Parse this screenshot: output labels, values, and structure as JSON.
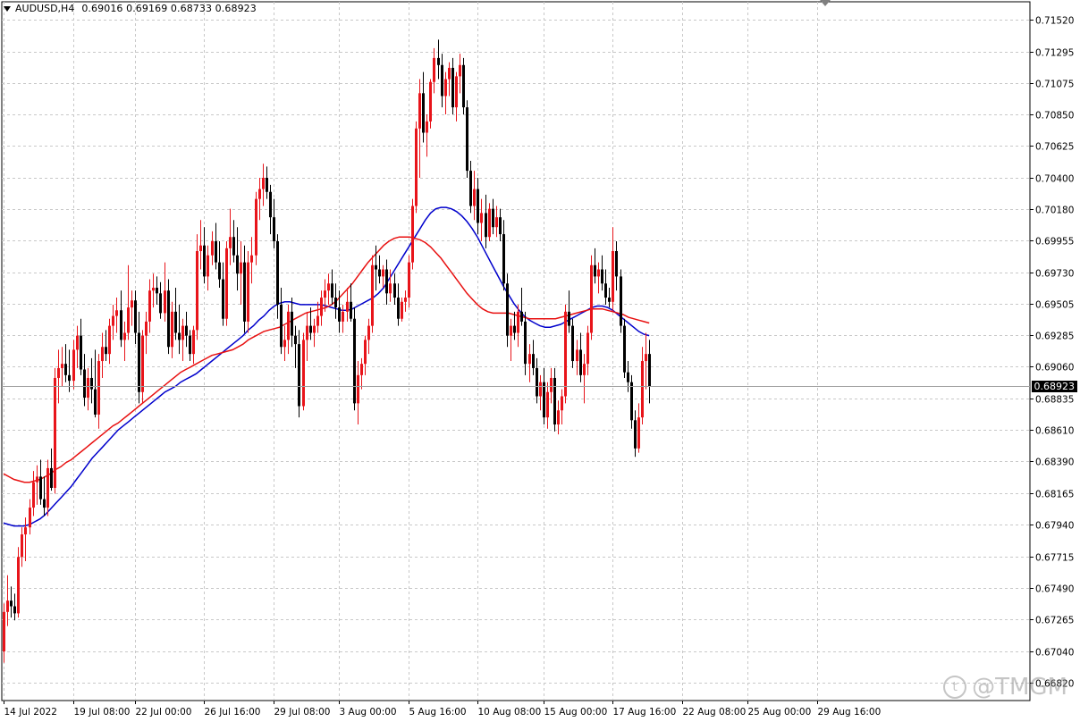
{
  "header": {
    "symbol": "AUDUSD,H4",
    "ohlc": "0.69016 0.69169 0.68733 0.68923"
  },
  "current_price": "0.68923",
  "watermark": "@TMGM",
  "colors": {
    "bull": "#e8141a",
    "bear": "#000000",
    "ma_fast": "#0000cc",
    "ma_slow": "#e81010",
    "grid": "#c8c8c8",
    "axis": "#000000"
  },
  "chart_data": {
    "type": "candlestick",
    "title": "AUDUSD,H4",
    "xlabel": "",
    "ylabel": "",
    "grid": true,
    "y_ticks": [
      "0.71520",
      "0.71295",
      "0.71075",
      "0.70850",
      "0.70625",
      "0.70400",
      "0.70180",
      "0.69955",
      "0.69730",
      "0.69505",
      "0.69285",
      "0.69060",
      "0.68835",
      "0.68610",
      "0.68390",
      "0.68165",
      "0.67940",
      "0.67715",
      "0.67490",
      "0.67265",
      "0.67040",
      "0.66820"
    ],
    "ylim": [
      0.6678,
      0.7156
    ],
    "x_tick_labels": [
      "14 Jul 2022",
      "19 Jul 08:00",
      "22 Jul 00:00",
      "26 Jul 16:00",
      "29 Jul 08:00",
      "3 Aug 00:00",
      "5 Aug 16:00",
      "10 Aug 08:00",
      "15 Aug 00:00",
      "17 Aug 16:00",
      "22 Aug 08:00",
      "25 Aug 00:00",
      "29 Aug 16:00"
    ],
    "x_tick_index": [
      0,
      19,
      36,
      55,
      74,
      92,
      111,
      130,
      148,
      167,
      186,
      204,
      223
    ],
    "last_price": 0.68923,
    "candles": [
      [
        0.6704,
        0.6738,
        0.6696,
        0.6732
      ],
      [
        0.6732,
        0.6758,
        0.6722,
        0.674
      ],
      [
        0.674,
        0.675,
        0.6728,
        0.6736
      ],
      [
        0.6736,
        0.6745,
        0.6726,
        0.6731
      ],
      [
        0.6731,
        0.6778,
        0.6728,
        0.6771
      ],
      [
        0.6771,
        0.6792,
        0.6764,
        0.6787
      ],
      [
        0.6787,
        0.6799,
        0.6768,
        0.6792
      ],
      [
        0.6792,
        0.6812,
        0.6787,
        0.6806
      ],
      [
        0.6806,
        0.6832,
        0.68,
        0.6824
      ],
      [
        0.6824,
        0.6836,
        0.6808,
        0.6828
      ],
      [
        0.6828,
        0.684,
        0.6808,
        0.6812
      ],
      [
        0.6812,
        0.6828,
        0.68,
        0.6806
      ],
      [
        0.6806,
        0.684,
        0.68,
        0.6834
      ],
      [
        0.6834,
        0.6848,
        0.6818,
        0.682
      ],
      [
        0.682,
        0.6905,
        0.6816,
        0.6898
      ],
      [
        0.6898,
        0.6918,
        0.688,
        0.6905
      ],
      [
        0.6905,
        0.692,
        0.6892,
        0.6908
      ],
      [
        0.6908,
        0.6922,
        0.6895,
        0.69
      ],
      [
        0.69,
        0.6918,
        0.6888,
        0.6896
      ],
      [
        0.6896,
        0.6925,
        0.689,
        0.6918
      ],
      [
        0.6918,
        0.6935,
        0.6905,
        0.6928
      ],
      [
        0.6928,
        0.694,
        0.69,
        0.6904
      ],
      [
        0.6904,
        0.6915,
        0.6878,
        0.6884
      ],
      [
        0.6884,
        0.6905,
        0.6875,
        0.6898
      ],
      [
        0.6898,
        0.6912,
        0.688,
        0.689
      ],
      [
        0.689,
        0.6918,
        0.687,
        0.6872
      ],
      [
        0.6872,
        0.6915,
        0.6862,
        0.691
      ],
      [
        0.691,
        0.693,
        0.6898,
        0.692
      ],
      [
        0.692,
        0.6932,
        0.691,
        0.6915
      ],
      [
        0.6915,
        0.694,
        0.6908,
        0.6935
      ],
      [
        0.6935,
        0.695,
        0.6925,
        0.6942
      ],
      [
        0.6942,
        0.6955,
        0.693,
        0.6946
      ],
      [
        0.6946,
        0.696,
        0.692,
        0.6925
      ],
      [
        0.6925,
        0.6938,
        0.691,
        0.693
      ],
      [
        0.693,
        0.6978,
        0.6925,
        0.6948
      ],
      [
        0.6948,
        0.696,
        0.6935,
        0.6953
      ],
      [
        0.6953,
        0.696,
        0.6922,
        0.693
      ],
      [
        0.693,
        0.6945,
        0.688,
        0.6888
      ],
      [
        0.6888,
        0.6932,
        0.688,
        0.6928
      ],
      [
        0.6928,
        0.6945,
        0.6915,
        0.6938
      ],
      [
        0.6938,
        0.6968,
        0.693,
        0.696
      ],
      [
        0.696,
        0.6972,
        0.6948,
        0.6962
      ],
      [
        0.6962,
        0.697,
        0.695,
        0.6958
      ],
      [
        0.6958,
        0.6966,
        0.694,
        0.6944
      ],
      [
        0.6944,
        0.698,
        0.6938,
        0.696
      ],
      [
        0.696,
        0.6968,
        0.6915,
        0.692
      ],
      [
        0.692,
        0.6952,
        0.6912,
        0.6945
      ],
      [
        0.6945,
        0.6962,
        0.6925,
        0.693
      ],
      [
        0.693,
        0.695,
        0.6915,
        0.6925
      ],
      [
        0.6925,
        0.694,
        0.691,
        0.6935
      ],
      [
        0.6935,
        0.6945,
        0.692,
        0.6928
      ],
      [
        0.6928,
        0.6932,
        0.691,
        0.6915
      ],
      [
        0.6915,
        0.6935,
        0.6908,
        0.6932
      ],
      [
        0.6932,
        0.7,
        0.6925,
        0.6988
      ],
      [
        0.6988,
        0.701,
        0.6975,
        0.6992
      ],
      [
        0.6992,
        0.7005,
        0.6965,
        0.697
      ],
      [
        0.697,
        0.6992,
        0.696,
        0.6985
      ],
      [
        0.6985,
        0.7002,
        0.6978,
        0.6995
      ],
      [
        0.6995,
        0.7008,
        0.6975,
        0.698
      ],
      [
        0.698,
        0.6995,
        0.6962,
        0.6968
      ],
      [
        0.6968,
        0.698,
        0.6935,
        0.694
      ],
      [
        0.694,
        0.6995,
        0.6935,
        0.699
      ],
      [
        0.699,
        0.7018,
        0.6978,
        0.6998
      ],
      [
        0.6998,
        0.701,
        0.698,
        0.6985
      ],
      [
        0.6985,
        0.7005,
        0.696,
        0.6972
      ],
      [
        0.6972,
        0.6995,
        0.695,
        0.698
      ],
      [
        0.698,
        0.6992,
        0.693,
        0.6938
      ],
      [
        0.6938,
        0.6988,
        0.693,
        0.698
      ],
      [
        0.698,
        0.6998,
        0.6965,
        0.6985
      ],
      [
        0.6985,
        0.703,
        0.6978,
        0.7025
      ],
      [
        0.7025,
        0.704,
        0.701,
        0.7032
      ],
      [
        0.7032,
        0.705,
        0.702,
        0.704
      ],
      [
        0.704,
        0.7048,
        0.7025,
        0.703
      ],
      [
        0.703,
        0.7035,
        0.7,
        0.7012
      ],
      [
        0.7012,
        0.7025,
        0.699,
        0.6995
      ],
      [
        0.6995,
        0.7,
        0.694,
        0.695
      ],
      [
        0.695,
        0.6962,
        0.6915,
        0.692
      ],
      [
        0.692,
        0.6935,
        0.691,
        0.6925
      ],
      [
        0.6925,
        0.695,
        0.6915,
        0.6945
      ],
      [
        0.6945,
        0.6955,
        0.692,
        0.6928
      ],
      [
        0.6928,
        0.6935,
        0.6905,
        0.6922
      ],
      [
        0.6922,
        0.6932,
        0.687,
        0.6878
      ],
      [
        0.6878,
        0.693,
        0.6875,
        0.6925
      ],
      [
        0.6925,
        0.6945,
        0.691,
        0.6935
      ],
      [
        0.6935,
        0.6948,
        0.6925,
        0.693
      ],
      [
        0.693,
        0.694,
        0.692,
        0.6935
      ],
      [
        0.6935,
        0.6952,
        0.693,
        0.6942
      ],
      [
        0.6942,
        0.696,
        0.6935,
        0.6955
      ],
      [
        0.6955,
        0.6968,
        0.6945,
        0.696
      ],
      [
        0.696,
        0.6972,
        0.695,
        0.6965
      ],
      [
        0.6965,
        0.6975,
        0.695,
        0.6955
      ],
      [
        0.6955,
        0.6965,
        0.694,
        0.6948
      ],
      [
        0.6948,
        0.696,
        0.693,
        0.6938
      ],
      [
        0.6938,
        0.695,
        0.693,
        0.6945
      ],
      [
        0.6945,
        0.6962,
        0.6938,
        0.6952
      ],
      [
        0.6952,
        0.6965,
        0.6938,
        0.694
      ],
      [
        0.694,
        0.6948,
        0.6875,
        0.688
      ],
      [
        0.688,
        0.691,
        0.6865,
        0.69
      ],
      [
        0.69,
        0.6912,
        0.689,
        0.6908
      ],
      [
        0.6908,
        0.6928,
        0.69,
        0.6925
      ],
      [
        0.6925,
        0.694,
        0.6915,
        0.6935
      ],
      [
        0.6935,
        0.6985,
        0.693,
        0.6978
      ],
      [
        0.6978,
        0.6992,
        0.696,
        0.6975
      ],
      [
        0.6975,
        0.6985,
        0.6965,
        0.697
      ],
      [
        0.697,
        0.6978,
        0.6962,
        0.6975
      ],
      [
        0.6975,
        0.6982,
        0.695,
        0.6958
      ],
      [
        0.6958,
        0.6975,
        0.6952,
        0.6965
      ],
      [
        0.6965,
        0.6972,
        0.695,
        0.6955
      ],
      [
        0.6955,
        0.6965,
        0.6935,
        0.694
      ],
      [
        0.694,
        0.6955,
        0.6938,
        0.6952
      ],
      [
        0.6952,
        0.696,
        0.6945,
        0.6955
      ],
      [
        0.6955,
        0.6985,
        0.6948,
        0.698
      ],
      [
        0.698,
        0.7025,
        0.6975,
        0.702
      ],
      [
        0.702,
        0.708,
        0.7015,
        0.7075
      ],
      [
        0.7075,
        0.711,
        0.704,
        0.71
      ],
      [
        0.71,
        0.7115,
        0.7065,
        0.7072
      ],
      [
        0.7072,
        0.7085,
        0.7055,
        0.708
      ],
      [
        0.708,
        0.711,
        0.7075,
        0.7108
      ],
      [
        0.7108,
        0.7132,
        0.71,
        0.7125
      ],
      [
        0.7125,
        0.7138,
        0.711,
        0.712
      ],
      [
        0.712,
        0.7128,
        0.709,
        0.7098
      ],
      [
        0.7098,
        0.7115,
        0.7085,
        0.711
      ],
      [
        0.711,
        0.7122,
        0.7098,
        0.7118
      ],
      [
        0.7118,
        0.7125,
        0.7085,
        0.709
      ],
      [
        0.709,
        0.7115,
        0.708,
        0.7112
      ],
      [
        0.7112,
        0.7128,
        0.71,
        0.712
      ],
      [
        0.712,
        0.7125,
        0.7085,
        0.709
      ],
      [
        0.709,
        0.7095,
        0.704,
        0.7045
      ],
      [
        0.7045,
        0.7052,
        0.7015,
        0.702
      ],
      [
        0.702,
        0.7045,
        0.701,
        0.7032
      ],
      [
        0.7032,
        0.704,
        0.7,
        0.7008
      ],
      [
        0.7008,
        0.7025,
        0.6995,
        0.7015
      ],
      [
        0.7015,
        0.7028,
        0.699,
        0.6998
      ],
      [
        0.6998,
        0.7022,
        0.6995,
        0.7018
      ],
      [
        0.7018,
        0.7025,
        0.7,
        0.7005
      ],
      [
        0.7005,
        0.702,
        0.6998,
        0.7012
      ],
      [
        0.7012,
        0.7018,
        0.6995,
        0.7
      ],
      [
        0.7,
        0.701,
        0.696,
        0.6965
      ],
      [
        0.6965,
        0.6972,
        0.692,
        0.6928
      ],
      [
        0.6928,
        0.694,
        0.691,
        0.6935
      ],
      [
        0.6935,
        0.6945,
        0.6925,
        0.693
      ],
      [
        0.693,
        0.695,
        0.692,
        0.6945
      ],
      [
        0.6945,
        0.6962,
        0.6935,
        0.6938
      ],
      [
        0.6938,
        0.6945,
        0.69,
        0.6908
      ],
      [
        0.6908,
        0.6922,
        0.6895,
        0.6915
      ],
      [
        0.6915,
        0.6925,
        0.69,
        0.6905
      ],
      [
        0.6905,
        0.6912,
        0.688,
        0.6885
      ],
      [
        0.6885,
        0.69,
        0.6875,
        0.6895
      ],
      [
        0.6895,
        0.6905,
        0.6865,
        0.687
      ],
      [
        0.687,
        0.6895,
        0.6862,
        0.6888
      ],
      [
        0.6888,
        0.6905,
        0.688,
        0.6898
      ],
      [
        0.6898,
        0.6905,
        0.686,
        0.6865
      ],
      [
        0.6865,
        0.6882,
        0.6858,
        0.6875
      ],
      [
        0.6875,
        0.689,
        0.6865,
        0.6885
      ],
      [
        0.6885,
        0.695,
        0.688,
        0.6945
      ],
      [
        0.6945,
        0.696,
        0.693,
        0.6935
      ],
      [
        0.6935,
        0.694,
        0.6905,
        0.691
      ],
      [
        0.691,
        0.6925,
        0.69,
        0.6918
      ],
      [
        0.6918,
        0.693,
        0.6895,
        0.69
      ],
      [
        0.69,
        0.6915,
        0.688,
        0.6908
      ],
      [
        0.6908,
        0.6935,
        0.69,
        0.693
      ],
      [
        0.693,
        0.6985,
        0.6925,
        0.6978
      ],
      [
        0.6978,
        0.699,
        0.6965,
        0.697
      ],
      [
        0.697,
        0.698,
        0.6958,
        0.6975
      ],
      [
        0.6975,
        0.6985,
        0.696,
        0.6965
      ],
      [
        0.6965,
        0.6975,
        0.695,
        0.6955
      ],
      [
        0.6955,
        0.6962,
        0.6948,
        0.6952
      ],
      [
        0.6952,
        0.7005,
        0.6945,
        0.6988
      ],
      [
        0.6988,
        0.6995,
        0.696,
        0.697
      ],
      [
        0.697,
        0.6975,
        0.693,
        0.6935
      ],
      [
        0.6935,
        0.694,
        0.6898,
        0.6902
      ],
      [
        0.6902,
        0.691,
        0.6888,
        0.6895
      ],
      [
        0.6895,
        0.69,
        0.6862,
        0.6868
      ],
      [
        0.6868,
        0.6875,
        0.6842,
        0.6848
      ],
      [
        0.6848,
        0.688,
        0.6845,
        0.687
      ],
      [
        0.687,
        0.692,
        0.6865,
        0.691
      ],
      [
        0.691,
        0.693,
        0.689,
        0.6915
      ],
      [
        0.6915,
        0.6925,
        0.688,
        0.6892
      ]
    ],
    "series": [
      {
        "values": [
          0.6795,
          0.6794,
          0.6793,
          0.6793,
          0.6793,
          0.6794,
          0.6796,
          0.6798,
          0.6801,
          0.6805,
          0.6809,
          0.6813,
          0.6817,
          0.6821,
          0.6826,
          0.6831,
          0.6836,
          0.6841,
          0.6845,
          0.6849,
          0.6853,
          0.6857,
          0.6861,
          0.6864,
          0.6867,
          0.687,
          0.6873,
          0.6876,
          0.6879,
          0.6882,
          0.6885,
          0.6888,
          0.689,
          0.6892,
          0.6895,
          0.6897,
          0.6899,
          0.6901,
          0.6904,
          0.6907,
          0.691,
          0.6913,
          0.6916,
          0.6919,
          0.6922,
          0.6925,
          0.6928,
          0.6932,
          0.6935,
          0.6939,
          0.6942,
          0.6946,
          0.6949,
          0.6951,
          0.6952,
          0.6952,
          0.6951,
          0.695,
          0.695,
          0.695,
          0.695,
          0.695,
          0.6949,
          0.6948,
          0.6947,
          0.6946,
          0.6946,
          0.6947,
          0.6949,
          0.6951,
          0.6953,
          0.6955,
          0.6958,
          0.6962,
          0.6968,
          0.6974,
          0.698,
          0.6986,
          0.6992,
          0.6998,
          0.7004,
          0.701,
          0.7015,
          0.7018,
          0.7019,
          0.7019,
          0.7018,
          0.7016,
          0.7013,
          0.7009,
          0.7004,
          0.6998,
          0.6991,
          0.6984,
          0.6977,
          0.697,
          0.6963,
          0.6957,
          0.6951,
          0.6946,
          0.6942,
          0.6939,
          0.6937,
          0.6935,
          0.6934,
          0.6934,
          0.6935,
          0.6936,
          0.6938,
          0.694,
          0.6942,
          0.6944,
          0.6946,
          0.6948,
          0.6949,
          0.6949,
          0.6948,
          0.6946,
          0.6943,
          0.694,
          0.6937,
          0.6934,
          0.6931,
          0.6929,
          0.6928
        ]
      },
      {
        "values": [
          0.683,
          0.6828,
          0.6826,
          0.6825,
          0.6824,
          0.6824,
          0.6825,
          0.6826,
          0.6828,
          0.683,
          0.6833,
          0.6835,
          0.6838,
          0.684,
          0.6843,
          0.6846,
          0.6849,
          0.6852,
          0.6855,
          0.6858,
          0.6861,
          0.6864,
          0.6866,
          0.6869,
          0.6872,
          0.6875,
          0.6878,
          0.6881,
          0.6884,
          0.6887,
          0.689,
          0.6893,
          0.6896,
          0.6899,
          0.6902,
          0.6904,
          0.6906,
          0.6908,
          0.691,
          0.6912,
          0.6914,
          0.6915,
          0.6916,
          0.6917,
          0.6918,
          0.692,
          0.6922,
          0.6925,
          0.6927,
          0.6929,
          0.6931,
          0.6932,
          0.6933,
          0.6934,
          0.6936,
          0.6938,
          0.694,
          0.6942,
          0.6944,
          0.6945,
          0.6946,
          0.6947,
          0.6948,
          0.695,
          0.6953,
          0.6957,
          0.6961,
          0.6965,
          0.697,
          0.6975,
          0.698,
          0.6984,
          0.6988,
          0.6992,
          0.6995,
          0.6997,
          0.6998,
          0.6998,
          0.6998,
          0.6997,
          0.6996,
          0.6994,
          0.6991,
          0.6987,
          0.6983,
          0.6978,
          0.6973,
          0.6968,
          0.6963,
          0.6958,
          0.6954,
          0.695,
          0.6947,
          0.6945,
          0.6944,
          0.6944,
          0.6944,
          0.6944,
          0.6943,
          0.6942,
          0.6941,
          0.694,
          0.694,
          0.694,
          0.694,
          0.694,
          0.694,
          0.6941,
          0.6942,
          0.6943,
          0.6944,
          0.6945,
          0.6946,
          0.6947,
          0.6947,
          0.6947,
          0.6946,
          0.6945,
          0.6944,
          0.6943,
          0.6941,
          0.694,
          0.6939,
          0.6938,
          0.6937
        ]
      }
    ]
  }
}
